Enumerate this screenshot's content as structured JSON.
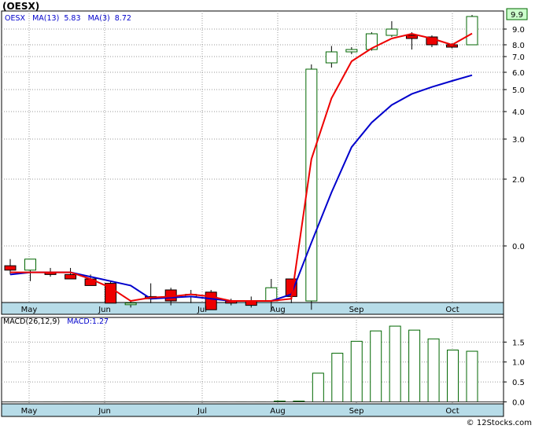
{
  "title": "(OESX)",
  "legend": {
    "ticker": "OESX",
    "ma13_label": "MA(13)",
    "ma13_value": "5.83",
    "ma3_label": "MA(3)",
    "ma3_value": "8.72"
  },
  "macd_legend": {
    "params_label": "MACD(26,12,9)",
    "macd_label": "MACD:",
    "macd_value": "1.27"
  },
  "last_price_tag": "9.9",
  "footer": "© 12Stocks.com",
  "colors": {
    "up_candle": "#006600",
    "down_candle": "#ee0000",
    "ma3_line": "#ee0000",
    "ma13_line": "#0000cc",
    "axis_band": "#b7dce8",
    "macd_bar": "#006600"
  },
  "chart_data": [
    {
      "type": "candlestick",
      "title": "(OESX)",
      "x_tick_labels": [
        "May",
        "Jun",
        "Jul",
        "Aug",
        "Sep",
        "Oct"
      ],
      "y_tick_labels": [
        "9.0",
        "8.0",
        "7.0",
        "6.0",
        "5.0",
        "4.0",
        "3.0",
        "2.0",
        "0.0"
      ],
      "candles": [
        {
          "o": -0.9,
          "h": -0.6,
          "l": -1.3,
          "c": -1.1
        },
        {
          "o": -1.1,
          "h": -0.6,
          "l": -1.6,
          "c": -0.6
        },
        {
          "o": -1.2,
          "h": -1.0,
          "l": -1.4,
          "c": -1.3
        },
        {
          "o": -1.3,
          "h": -1.0,
          "l": -1.5,
          "c": -1.5
        },
        {
          "o": -1.5,
          "h": -1.3,
          "l": -1.8,
          "c": -1.8
        },
        {
          "o": -1.7,
          "h": -1.6,
          "l": -2.6,
          "c": -2.6
        },
        {
          "o": -2.6,
          "h": -2.5,
          "l": -2.8,
          "c": -2.6
        },
        {
          "o": -2.3,
          "h": -1.7,
          "l": -2.6,
          "c": -2.4
        },
        {
          "o": -2.0,
          "h": -1.9,
          "l": -2.7,
          "c": -2.5
        },
        {
          "o": -2.3,
          "h": -2.0,
          "l": -2.6,
          "c": -2.2
        },
        {
          "o": -2.1,
          "h": -2.0,
          "l": -2.8,
          "c": -2.9
        },
        {
          "o": -2.5,
          "h": -2.4,
          "l": -2.7,
          "c": -2.6
        },
        {
          "o": -2.5,
          "h": -2.3,
          "l": -2.8,
          "c": -2.7
        },
        {
          "o": -2.5,
          "h": -1.5,
          "l": -2.9,
          "c": -1.9
        },
        {
          "o": -1.5,
          "h": -1.5,
          "l": -2.6,
          "c": -2.3
        },
        {
          "o": -2.5,
          "h": 6.5,
          "l": -2.9,
          "c": 6.2
        },
        {
          "o": 6.6,
          "h": 7.9,
          "l": 6.3,
          "c": 7.4
        },
        {
          "o": 7.4,
          "h": 7.8,
          "l": 7.2,
          "c": 7.6
        },
        {
          "o": 7.6,
          "h": 8.8,
          "l": 7.5,
          "c": 8.7
        },
        {
          "o": 8.6,
          "h": 9.5,
          "l": 8.5,
          "c": 9.0
        },
        {
          "o": 8.6,
          "h": 8.8,
          "l": 7.6,
          "c": 8.4
        },
        {
          "o": 8.5,
          "h": 8.6,
          "l": 7.8,
          "c": 8.0
        },
        {
          "o": 8.0,
          "h": 8.1,
          "l": 7.7,
          "c": 7.8
        },
        {
          "o": 8.0,
          "h": 9.9,
          "l": 8.0,
          "c": 9.8
        }
      ],
      "series": [
        {
          "name": "MA(13)",
          "values": [
            -1.3,
            -1.2,
            -1.2,
            -1.2,
            -1.4,
            -1.6,
            -1.8,
            -2.4,
            -2.35,
            -2.3,
            -2.4,
            -2.5,
            -2.5,
            -2.5,
            -2.2,
            0.1,
            1.6,
            2.8,
            3.6,
            4.3,
            4.8,
            5.15,
            5.5,
            5.83
          ]
        },
        {
          "name": "MA(3)",
          "values": [
            -1.2,
            -1.2,
            -1.2,
            -1.2,
            -1.5,
            -1.9,
            -2.5,
            -2.35,
            -2.3,
            -2.2,
            -2.3,
            -2.5,
            -2.5,
            -2.5,
            -2.4,
            2.5,
            4.6,
            6.7,
            7.7,
            8.4,
            8.7,
            8.4,
            8.0,
            8.72
          ]
        }
      ],
      "last_value_marker": 9.9
    },
    {
      "type": "bar",
      "title": "MACD(26,12,9)",
      "y_tick_labels": [
        "1.5",
        "1.0",
        "0.5",
        "0.0"
      ],
      "ylim": [
        -0.05,
        2.0
      ],
      "values": [
        0,
        0,
        0,
        0,
        0,
        0,
        0,
        0,
        0,
        0,
        0,
        0,
        0,
        0,
        0.02,
        0.02,
        0.72,
        1.22,
        1.52,
        1.78,
        1.9,
        1.8,
        1.58,
        1.3,
        1.27
      ]
    }
  ]
}
